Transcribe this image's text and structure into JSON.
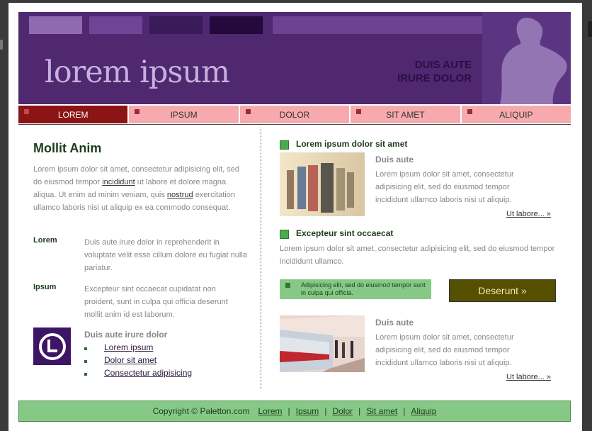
{
  "header": {
    "logo_text": "lorem ipsum",
    "slogan_line1": "DUIS AUTE",
    "slogan_line2": "IRURE DOLOR"
  },
  "nav": {
    "items": [
      {
        "label": "LOREM",
        "active": true
      },
      {
        "label": "IPSUM",
        "active": false
      },
      {
        "label": "DOLOR",
        "active": false
      },
      {
        "label": "SIT AMET",
        "active": false
      },
      {
        "label": "ALIQUIP",
        "active": false
      }
    ]
  },
  "left": {
    "heading": "Mollit Anim",
    "para_part1": "Lorem ipsum dolor sit amet, consectetur adipisicing elit, sed do eiusmod tempor",
    "link1": "incididunt",
    "para_part2": "ut labore et dolore magna aliqua. Ut enim ad minim veniam, quis",
    "link2": "nostrud",
    "para_part3": "exercitation ullamco laboris nisi ut aliquip ex ea commodo consequat.",
    "def1_term": "Lorem",
    "def1_desc": "Duis aute irure dolor in reprehenderit in voluptate velit esse cillum dolore eu fugiat nulla pariatur.",
    "def2_term": "Ipsum",
    "def2_desc": "Excepteur sint occaecat cupidatat non proident, sunt in culpa qui officia deserunt mollit anim id est laborum.",
    "links_title": "Duis aute irure dolor",
    "links": [
      "Lorem ipsum",
      "Dolor sit amet",
      "Consectetur adipisicing"
    ]
  },
  "right": {
    "section1_title": "Lorem ipsum dolor sit amet",
    "item1_title": "Duis aute",
    "item1_text": "Lorem ipsum dolor sit amet, consectetur adipisicing elit, sed do eiusmod tempor incididunt ullamco laboris nisi ut aliquip.",
    "item1_more": "Ut labore... »",
    "section2_title": "Excepteur sint occaecat",
    "section2_text": "Lorem ipsum dolor sit amet, consectetur adipisicing elit, sed do eiusmod tempor incididunt ullamco.",
    "note_text": "Adipisicing elit, sed do eiusmod tempor sunt in culpa qui officia.",
    "cta_label": "Deserunt »",
    "item2_title": "Duis aute",
    "item2_text": "Lorem ipsum dolor sit amet, consectetur adipisicing elit, sed do eiusmod tempor incididunt ullamco laboris nisi ut aliquip.",
    "item2_more": "Ut labore... »"
  },
  "footer": {
    "copyright": "Copyright © Paletton.com",
    "links": [
      "Lorem",
      "Ipsum",
      "Dolor",
      "Sit amet",
      "Aliquip"
    ]
  },
  "colors": {
    "header_bg": "#4f2870",
    "nav_active": "#8b1414",
    "nav_idle": "#f6aaae",
    "green_accent": "#86c986",
    "cta_bg": "#555000"
  }
}
